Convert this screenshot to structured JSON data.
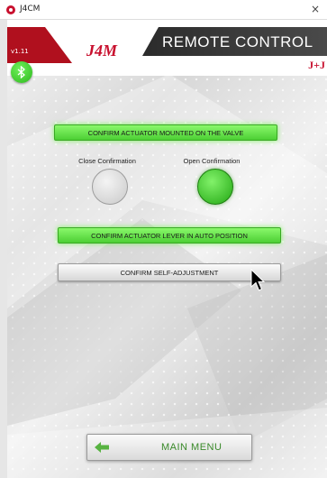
{
  "window": {
    "app_title": "J4CM",
    "close_glyph": "×",
    "version": "v1.11",
    "header_title": "REMOTE CONTROL",
    "brand": "J+J",
    "logo_text": "J4M"
  },
  "main": {
    "confirm_mounted": "CONFIRM ACTUATOR MOUNTED ON THE VALVE",
    "close_confirmation_label": "Close Confirmation",
    "open_confirmation_label": "Open Confirmation",
    "close_confirmation_state": "off",
    "open_confirmation_state": "on",
    "confirm_lever": "CONFIRM ACTUATOR LEVER IN AUTO POSITION",
    "confirm_self_adjust": "CONFIRM SELF-ADJUSTMENT",
    "main_menu": "MAIN MENU"
  },
  "icons": {
    "bluetooth": "bluetooth-icon",
    "back": "back-arrow-icon",
    "app": "app-icon",
    "cursor": "mouse-cursor-icon"
  },
  "colors": {
    "accent_green": "#4ccf34",
    "brand_red": "#c8102e",
    "menu_text": "#3a8a2a"
  }
}
